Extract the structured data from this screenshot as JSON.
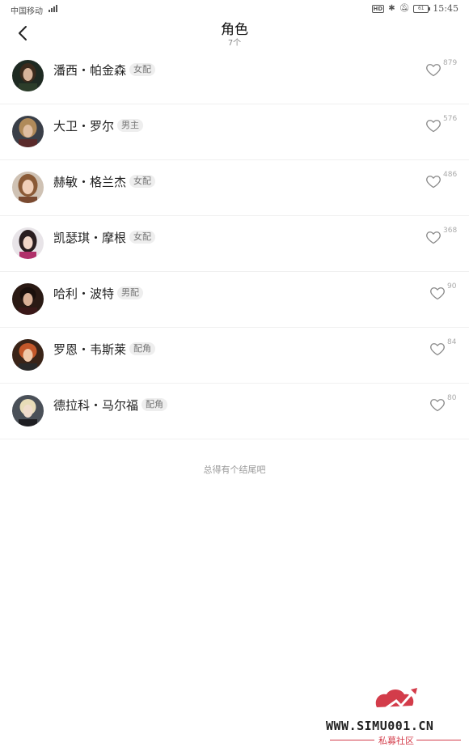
{
  "status_bar": {
    "carrier": "中国移动",
    "network": "4G",
    "hd": "HD",
    "battery": "61",
    "time": "15:45"
  },
  "header": {
    "title": "角色",
    "subtitle": "7个"
  },
  "characters": [
    {
      "name": "潘西・帕金森",
      "tag": "女配",
      "likes": "879"
    },
    {
      "name": "大卫・罗尔",
      "tag": "男主",
      "likes": "576"
    },
    {
      "name": "赫敏・格兰杰",
      "tag": "女配",
      "likes": "486"
    },
    {
      "name": "凯瑟琪・摩根",
      "tag": "女配",
      "likes": "368"
    },
    {
      "name": "哈利・波特",
      "tag": "男配",
      "likes": "90"
    },
    {
      "name": "罗恩・韦斯莱",
      "tag": "配角",
      "likes": "84"
    },
    {
      "name": "德拉科・马尔福",
      "tag": "配角",
      "likes": "80"
    }
  ],
  "footer_note": "总得有个结尾吧",
  "watermark": {
    "url": "WWW.SIMU001.CN",
    "label": "私募社区"
  },
  "colors": {
    "accent_red": "#d33c4a",
    "divider": "#f0f0f0",
    "tag_bg": "#eeeeee"
  }
}
